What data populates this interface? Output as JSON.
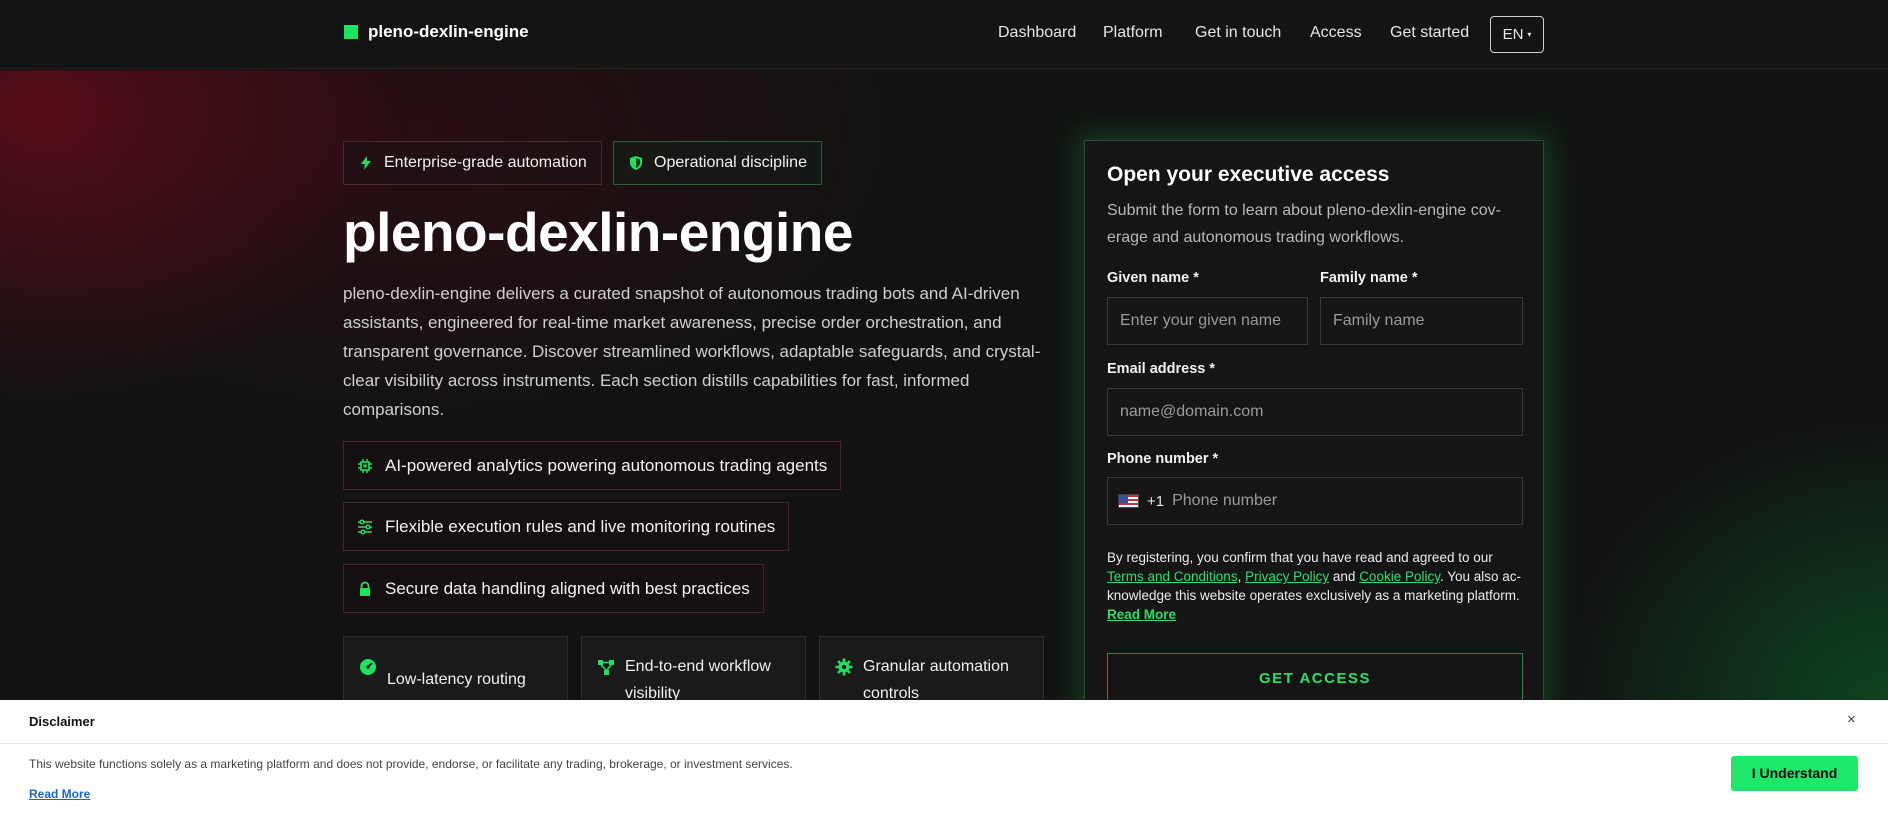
{
  "brand": {
    "name": "pleno-dexlin-engine",
    "accent": "#1ee15f"
  },
  "nav": {
    "links": [
      "Dashboard",
      "Platform",
      "Get in touch",
      "Access",
      "Get started"
    ],
    "language": "EN"
  },
  "hero": {
    "badges": [
      {
        "label": "Enterprise-grade automation",
        "icon": "bolt-icon"
      },
      {
        "label": "Operational discipline",
        "icon": "shield-icon"
      }
    ],
    "title": "pleno-dexlin-engine",
    "description": "pleno-dexlin-engine delivers a curated snapshot of autonomous trading bots and AI-driven assistants, engineered for real-time market awareness, precise order orchestration, and transparent governance. Discover streamlined workflows, adaptable safeguards, and crystal-clear visibility across instruments. Each section distills capabilities for fast, informed comparisons.",
    "features": [
      {
        "label": "AI-powered analytics powering autonomous trading agents",
        "icon": "chip-icon"
      },
      {
        "label": "Flexible execution rules and live monitoring routines",
        "icon": "sliders-icon"
      },
      {
        "label": "Secure data handling aligned with best practices",
        "icon": "lock-icon"
      }
    ],
    "cards": [
      {
        "label": "Low-latency routing",
        "icon": "gauge-icon"
      },
      {
        "label": "End-to-end workflow visibility",
        "icon": "flow-icon"
      },
      {
        "label": "Granular automation controls",
        "icon": "gear-icon"
      }
    ]
  },
  "form": {
    "title": "Open your executive access",
    "subtitle": "Submit the form to learn about pleno-dexlin-engine cov-erage and autonomous trading workflows.",
    "given_label": "Given name *",
    "given_placeholder": "Enter your given name",
    "family_label": "Family name *",
    "family_placeholder": "Family name",
    "email_label": "Email address *",
    "email_placeholder": "name@domain.com",
    "phone_label": "Phone number *",
    "phone_code": "+1",
    "phone_placeholder": "Phone number",
    "legal_prefix": "By registering, you confirm that you have read and agreed to our",
    "terms": "Terms and Conditions",
    "privacy": "Privacy Policy",
    "and": "and",
    "cookie": "Cookie Policy",
    "legal_suffix": ". You also ac-knowledge this website operates exclusively as a marketing platform.",
    "read_more": "Read More",
    "submit": "GET ACCESS"
  },
  "disclaimer": {
    "title": "Disclaimer",
    "close": "×",
    "text": "This website functions solely as a marketing platform and does not provide, endorse, or facilitate any trading, brokerage, or investment services.",
    "read_more": "Read More",
    "button": "I Understand"
  }
}
